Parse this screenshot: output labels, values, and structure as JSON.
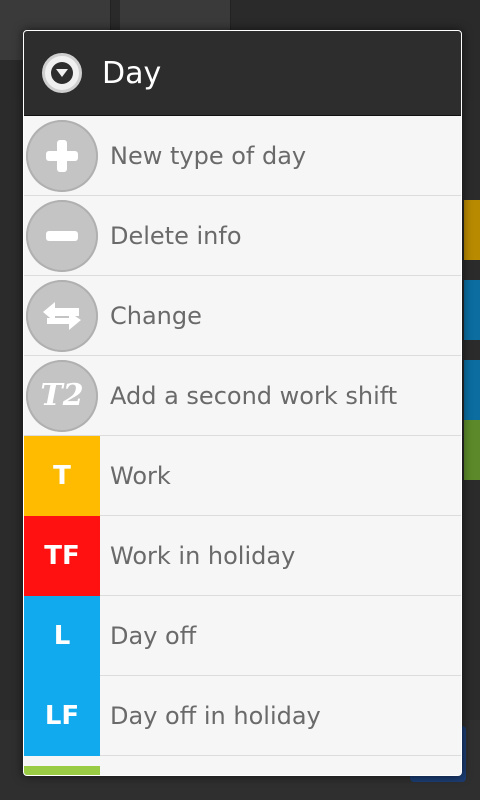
{
  "dialog": {
    "title": "Day",
    "items": [
      {
        "label": "New type of day",
        "icon": "plus-icon"
      },
      {
        "label": "Delete info",
        "icon": "minus-icon"
      },
      {
        "label": "Change",
        "icon": "swap-arrows-icon"
      },
      {
        "label": "Add a second work shift",
        "icon": "t2-icon",
        "icon_text": "T2"
      },
      {
        "label": "Work",
        "code": "T",
        "color": "#ffbb00"
      },
      {
        "label": "Work in holiday",
        "code": "TF",
        "color": "#ff1111"
      },
      {
        "label": "Day off",
        "code": "L",
        "color": "#11aaee"
      },
      {
        "label": "Day off in holiday",
        "code": "LF",
        "color": "#11aaee"
      }
    ],
    "partial_item_color": "#99cc44"
  }
}
